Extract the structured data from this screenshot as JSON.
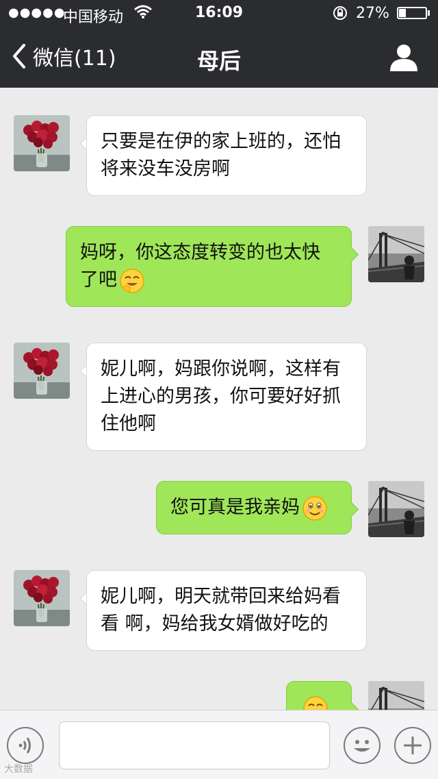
{
  "status_bar": {
    "signal": "●●●●●",
    "carrier": "中国移动",
    "time": "16:09",
    "battery_percent_text": "27%",
    "battery_level": 0.27
  },
  "nav": {
    "back_label": "微信(11)",
    "title": "母后"
  },
  "messages": [
    {
      "side": "in",
      "text": "只要是在伊的家上班的，还怕将来没车没房啊"
    },
    {
      "side": "out",
      "text": "妈呀，你这态度转变的也太快了吧",
      "emoji": "grin-hand-emoji"
    },
    {
      "side": "in",
      "text": "妮儿啊，妈跟你说啊，这样有上进心的男孩，你可要好好抓住他啊"
    },
    {
      "side": "out",
      "text": "您可真是我亲妈",
      "emoji": "smile-emoji"
    },
    {
      "side": "in",
      "text": "妮儿啊，明天就带回来给妈看看 啊，妈给我女婿做好吃的"
    },
    {
      "side": "out",
      "text": "",
      "emoji": "grin-hand-emoji"
    }
  ],
  "input_bar": {
    "voice_icon": "voice-icon",
    "emoji_icon": "emoji-icon",
    "plus_icon": "plus-icon",
    "text_value": ""
  },
  "watermark": "大数据"
}
